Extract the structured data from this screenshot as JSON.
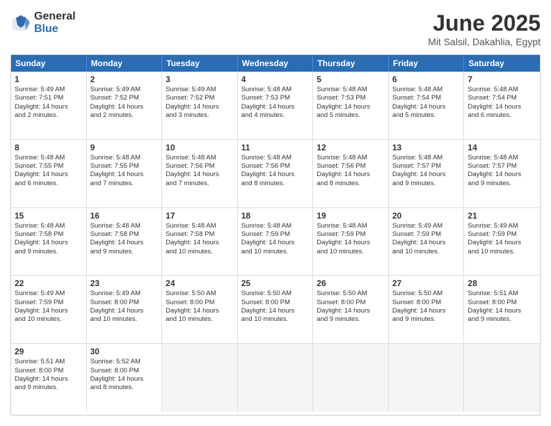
{
  "logo": {
    "general": "General",
    "blue": "Blue"
  },
  "title": "June 2025",
  "location": "Mit Salsil, Dakahlia, Egypt",
  "days": [
    "Sunday",
    "Monday",
    "Tuesday",
    "Wednesday",
    "Thursday",
    "Friday",
    "Saturday"
  ],
  "weeks": [
    [
      {
        "day": "1",
        "lines": [
          "Sunrise: 5:49 AM",
          "Sunset: 7:51 PM",
          "Daylight: 14 hours",
          "and 2 minutes."
        ]
      },
      {
        "day": "2",
        "lines": [
          "Sunrise: 5:49 AM",
          "Sunset: 7:52 PM",
          "Daylight: 14 hours",
          "and 2 minutes."
        ]
      },
      {
        "day": "3",
        "lines": [
          "Sunrise: 5:49 AM",
          "Sunset: 7:52 PM",
          "Daylight: 14 hours",
          "and 3 minutes."
        ]
      },
      {
        "day": "4",
        "lines": [
          "Sunrise: 5:48 AM",
          "Sunset: 7:53 PM",
          "Daylight: 14 hours",
          "and 4 minutes."
        ]
      },
      {
        "day": "5",
        "lines": [
          "Sunrise: 5:48 AM",
          "Sunset: 7:53 PM",
          "Daylight: 14 hours",
          "and 5 minutes."
        ]
      },
      {
        "day": "6",
        "lines": [
          "Sunrise: 5:48 AM",
          "Sunset: 7:54 PM",
          "Daylight: 14 hours",
          "and 5 minutes."
        ]
      },
      {
        "day": "7",
        "lines": [
          "Sunrise: 5:48 AM",
          "Sunset: 7:54 PM",
          "Daylight: 14 hours",
          "and 6 minutes."
        ]
      }
    ],
    [
      {
        "day": "8",
        "lines": [
          "Sunrise: 5:48 AM",
          "Sunset: 7:55 PM",
          "Daylight: 14 hours",
          "and 6 minutes."
        ]
      },
      {
        "day": "9",
        "lines": [
          "Sunrise: 5:48 AM",
          "Sunset: 7:55 PM",
          "Daylight: 14 hours",
          "and 7 minutes."
        ]
      },
      {
        "day": "10",
        "lines": [
          "Sunrise: 5:48 AM",
          "Sunset: 7:56 PM",
          "Daylight: 14 hours",
          "and 7 minutes."
        ]
      },
      {
        "day": "11",
        "lines": [
          "Sunrise: 5:48 AM",
          "Sunset: 7:56 PM",
          "Daylight: 14 hours",
          "and 8 minutes."
        ]
      },
      {
        "day": "12",
        "lines": [
          "Sunrise: 5:48 AM",
          "Sunset: 7:56 PM",
          "Daylight: 14 hours",
          "and 8 minutes."
        ]
      },
      {
        "day": "13",
        "lines": [
          "Sunrise: 5:48 AM",
          "Sunset: 7:57 PM",
          "Daylight: 14 hours",
          "and 9 minutes."
        ]
      },
      {
        "day": "14",
        "lines": [
          "Sunrise: 5:48 AM",
          "Sunset: 7:57 PM",
          "Daylight: 14 hours",
          "and 9 minutes."
        ]
      }
    ],
    [
      {
        "day": "15",
        "lines": [
          "Sunrise: 5:48 AM",
          "Sunset: 7:58 PM",
          "Daylight: 14 hours",
          "and 9 minutes."
        ]
      },
      {
        "day": "16",
        "lines": [
          "Sunrise: 5:48 AM",
          "Sunset: 7:58 PM",
          "Daylight: 14 hours",
          "and 9 minutes."
        ]
      },
      {
        "day": "17",
        "lines": [
          "Sunrise: 5:48 AM",
          "Sunset: 7:58 PM",
          "Daylight: 14 hours",
          "and 10 minutes."
        ]
      },
      {
        "day": "18",
        "lines": [
          "Sunrise: 5:48 AM",
          "Sunset: 7:59 PM",
          "Daylight: 14 hours",
          "and 10 minutes."
        ]
      },
      {
        "day": "19",
        "lines": [
          "Sunrise: 5:48 AM",
          "Sunset: 7:59 PM",
          "Daylight: 14 hours",
          "and 10 minutes."
        ]
      },
      {
        "day": "20",
        "lines": [
          "Sunrise: 5:49 AM",
          "Sunset: 7:59 PM",
          "Daylight: 14 hours",
          "and 10 minutes."
        ]
      },
      {
        "day": "21",
        "lines": [
          "Sunrise: 5:49 AM",
          "Sunset: 7:59 PM",
          "Daylight: 14 hours",
          "and 10 minutes."
        ]
      }
    ],
    [
      {
        "day": "22",
        "lines": [
          "Sunrise: 5:49 AM",
          "Sunset: 7:59 PM",
          "Daylight: 14 hours",
          "and 10 minutes."
        ]
      },
      {
        "day": "23",
        "lines": [
          "Sunrise: 5:49 AM",
          "Sunset: 8:00 PM",
          "Daylight: 14 hours",
          "and 10 minutes."
        ]
      },
      {
        "day": "24",
        "lines": [
          "Sunrise: 5:50 AM",
          "Sunset: 8:00 PM",
          "Daylight: 14 hours",
          "and 10 minutes."
        ]
      },
      {
        "day": "25",
        "lines": [
          "Sunrise: 5:50 AM",
          "Sunset: 8:00 PM",
          "Daylight: 14 hours",
          "and 10 minutes."
        ]
      },
      {
        "day": "26",
        "lines": [
          "Sunrise: 5:50 AM",
          "Sunset: 8:00 PM",
          "Daylight: 14 hours",
          "and 9 minutes."
        ]
      },
      {
        "day": "27",
        "lines": [
          "Sunrise: 5:50 AM",
          "Sunset: 8:00 PM",
          "Daylight: 14 hours",
          "and 9 minutes."
        ]
      },
      {
        "day": "28",
        "lines": [
          "Sunrise: 5:51 AM",
          "Sunset: 8:00 PM",
          "Daylight: 14 hours",
          "and 9 minutes."
        ]
      }
    ],
    [
      {
        "day": "29",
        "lines": [
          "Sunrise: 5:51 AM",
          "Sunset: 8:00 PM",
          "Daylight: 14 hours",
          "and 9 minutes."
        ]
      },
      {
        "day": "30",
        "lines": [
          "Sunrise: 5:52 AM",
          "Sunset: 8:00 PM",
          "Daylight: 14 hours",
          "and 8 minutes."
        ]
      },
      {
        "day": "",
        "lines": []
      },
      {
        "day": "",
        "lines": []
      },
      {
        "day": "",
        "lines": []
      },
      {
        "day": "",
        "lines": []
      },
      {
        "day": "",
        "lines": []
      }
    ]
  ]
}
